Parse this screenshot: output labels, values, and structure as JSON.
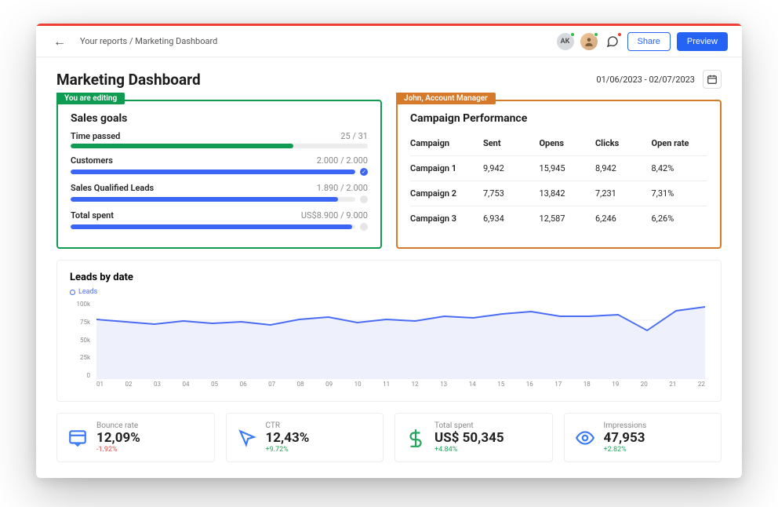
{
  "breadcrumb": "Your reports / Marketing Dashboard",
  "avatar_initials": "AK",
  "buttons": {
    "share": "Share",
    "preview": "Preview"
  },
  "page_title": "Marketing Dashboard",
  "date_range": "01/06/2023 - 02/07/2023",
  "editing_tag": "You are editing",
  "collab_tag": "John, Account Manager",
  "sales_goals": {
    "title": "Sales goals",
    "rows": [
      {
        "label": "Time passed",
        "value": "25 / 31",
        "pct": 75,
        "color": "green",
        "end": "none"
      },
      {
        "label": "Customers",
        "value": "2.000 / 2.000",
        "pct": 100,
        "color": "blue",
        "end": "check"
      },
      {
        "label": "Sales Qualified Leads",
        "value": "1.890 / 2.000",
        "pct": 94,
        "color": "blue",
        "end": "dot"
      },
      {
        "label": "Total spent",
        "value": "US$8.900 / 9.000",
        "pct": 99,
        "color": "blue",
        "end": "dot"
      }
    ]
  },
  "campaign_perf": {
    "title": "Campaign Performance",
    "headers": [
      "Campaign",
      "Sent",
      "Opens",
      "Clicks",
      "Open rate"
    ],
    "rows": [
      {
        "name": "Campaign 1",
        "sent": "9,942",
        "opens": "15,945",
        "clicks": "8,942",
        "rate": "8,42%"
      },
      {
        "name": "Campaign 2",
        "sent": "7,753",
        "opens": "13,842",
        "clicks": "7,231",
        "rate": "7,31%"
      },
      {
        "name": "Campaign 3",
        "sent": "6,934",
        "opens": "12,587",
        "clicks": "6,246",
        "rate": "6,26%"
      }
    ]
  },
  "leads_title": "Leads by date",
  "leads_legend": "Leads",
  "chart_data": {
    "type": "line",
    "title": "Leads by date",
    "ylabel": "",
    "xlabel": "",
    "ylim": [
      0,
      100
    ],
    "y_ticks": [
      "100k",
      "75k",
      "50k",
      "25k",
      "0"
    ],
    "categories": [
      "01",
      "02",
      "03",
      "04",
      "05",
      "06",
      "07",
      "08",
      "09",
      "10",
      "11",
      "12",
      "13",
      "14",
      "15",
      "16",
      "17",
      "18",
      "19",
      "20",
      "21",
      "22"
    ],
    "series": [
      {
        "name": "Leads",
        "values": [
          76,
          73,
          70,
          74,
          71,
          73,
          69,
          76,
          79,
          72,
          76,
          74,
          80,
          78,
          83,
          86,
          80,
          80,
          82,
          62,
          87,
          92
        ]
      }
    ]
  },
  "kpis": [
    {
      "label": "Bounce rate",
      "value": "12,09%",
      "delta": "-1.92%",
      "dir": "neg",
      "icon": "browser"
    },
    {
      "label": "CTR",
      "value": "12,43%",
      "delta": "+9.72%",
      "dir": "pos",
      "icon": "cursor"
    },
    {
      "label": "Total spent",
      "value": "US$ 50,345",
      "delta": "+4.84%",
      "dir": "pos",
      "icon": "dollar"
    },
    {
      "label": "Impressions",
      "value": "47,953",
      "delta": "+2.82%",
      "dir": "pos",
      "icon": "eye"
    }
  ]
}
